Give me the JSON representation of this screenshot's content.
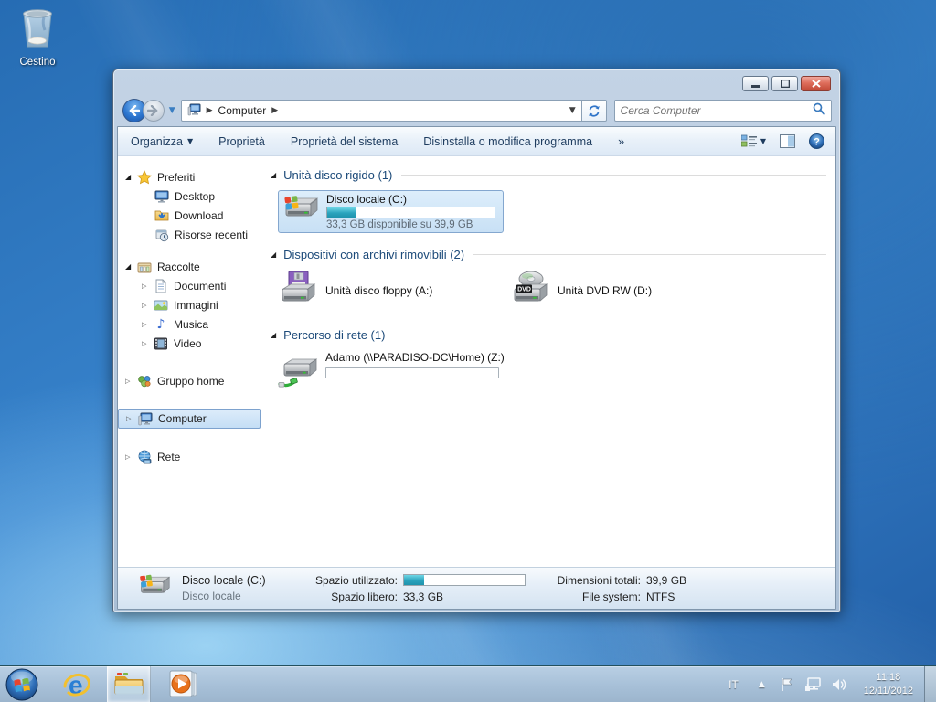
{
  "desktop": {
    "recycle_bin_label": "Cestino"
  },
  "explorer": {
    "nav": {
      "breadcrumb_root": "Computer",
      "search_placeholder": "Cerca Computer"
    },
    "toolbar": {
      "organize": "Organizza",
      "properties": "Proprietà",
      "system_properties": "Proprietà del sistema",
      "uninstall": "Disinstalla o modifica programma",
      "overflow": "»"
    },
    "sidebar": {
      "favorites": {
        "label": "Preferiti",
        "items": [
          "Desktop",
          "Download",
          "Risorse recenti"
        ]
      },
      "libraries": {
        "label": "Raccolte",
        "items": [
          "Documenti",
          "Immagini",
          "Musica",
          "Video"
        ]
      },
      "homegroup": "Gruppo home",
      "computer": "Computer",
      "network": "Rete"
    },
    "sections": {
      "hdd": {
        "title": "Unità disco rigido (1)",
        "drive_name": "Disco locale (C:)",
        "drive_caption": "33,3 GB disponibile su 39,9 GB",
        "used_percent": 17
      },
      "removable": {
        "title": "Dispositivi con archivi rimovibili (2)",
        "floppy_name": "Unità disco floppy (A:)",
        "dvd_name": "Unità DVD RW (D:)"
      },
      "network": {
        "title": "Percorso di rete (1)",
        "drive_name": "Adamo (\\\\PARADISO-DC\\Home) (Z:)",
        "used_percent": 0
      }
    },
    "details": {
      "name": "Disco locale (C:)",
      "type": "Disco locale",
      "used_label": "Spazio utilizzato:",
      "used_percent": 17,
      "free_label": "Spazio libero:",
      "free_value": "33,3 GB",
      "total_label": "Dimensioni totali:",
      "total_value": "39,9 GB",
      "fs_label": "File system:",
      "fs_value": "NTFS"
    }
  },
  "taskbar": {
    "tray": {
      "language": "IT",
      "time": "11:18",
      "date": "12/11/2012"
    }
  },
  "colors": {
    "selection_border": "#7da2ce",
    "usage_bar_fill": "#2aa3bd",
    "section_header_text": "#1c4a79",
    "close_button": "#c14936"
  }
}
